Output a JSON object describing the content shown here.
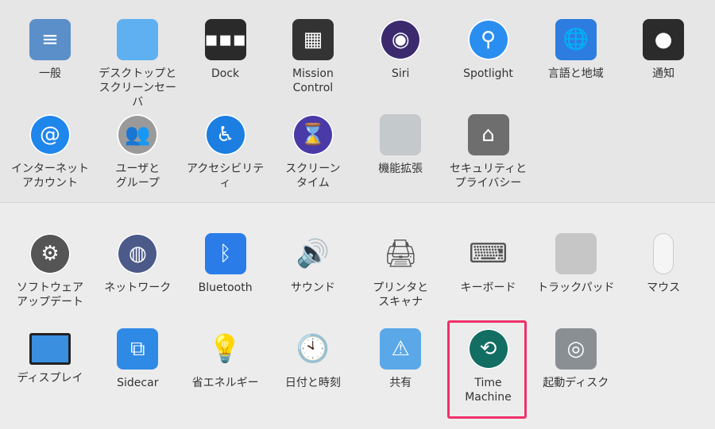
{
  "sections": [
    {
      "items": [
        {
          "label": "一般",
          "icon": "general-icon",
          "glyph": "≡",
          "bg": "#5a8fc9",
          "shape": "square"
        },
        {
          "label": "デスクトップと\nスクリーンセーバ",
          "icon": "desktop-screensaver-icon",
          "glyph": "",
          "bg": "#5fb0f0",
          "shape": "square"
        },
        {
          "label": "Dock",
          "icon": "dock-icon",
          "glyph": "▪▪▪",
          "bg": "#2a2a2a",
          "shape": "square"
        },
        {
          "label": "Mission\nControl",
          "icon": "mission-control-icon",
          "glyph": "▦",
          "bg": "#333333",
          "shape": "square"
        },
        {
          "label": "Siri",
          "icon": "siri-icon",
          "glyph": "◉",
          "bg": "#3b2a6e",
          "shape": "circle"
        },
        {
          "label": "Spotlight",
          "icon": "spotlight-icon",
          "glyph": "⚲",
          "bg": "#2a8ef0",
          "shape": "circle"
        },
        {
          "label": "言語と地域",
          "icon": "language-region-icon",
          "glyph": "🌐",
          "bg": "#2d7de0",
          "shape": "square"
        },
        {
          "label": "通知",
          "icon": "notifications-icon",
          "glyph": "●",
          "bg": "#2b2b2b",
          "shape": "square"
        }
      ]
    },
    {
      "items": [
        {
          "label": "インターネット\nアカウント",
          "icon": "internet-accounts-icon",
          "glyph": "@",
          "bg": "#1f86ec",
          "shape": "circle"
        },
        {
          "label": "ユーザと\nグループ",
          "icon": "users-groups-icon",
          "glyph": "👥",
          "bg": "#9a9a9a",
          "shape": "circle"
        },
        {
          "label": "アクセシビリティ",
          "icon": "accessibility-icon",
          "glyph": "♿",
          "bg": "#1b7ee0",
          "shape": "circle"
        },
        {
          "label": "スクリーン\nタイム",
          "icon": "screen-time-icon",
          "glyph": "⌛",
          "bg": "#4a3aa8",
          "shape": "circle"
        },
        {
          "label": "機能拡張",
          "icon": "extensions-icon",
          "glyph": "",
          "bg": "#c4c9cc",
          "shape": "square"
        },
        {
          "label": "セキュリティと\nプライバシー",
          "icon": "security-privacy-icon",
          "glyph": "⌂",
          "bg": "#6e6e6e",
          "shape": "square"
        }
      ]
    },
    {
      "items": [
        {
          "label": "ソフトウェア\nアップデート",
          "icon": "software-update-icon",
          "glyph": "⚙",
          "bg": "#555555",
          "shape": "circle"
        },
        {
          "label": "ネットワーク",
          "icon": "network-icon",
          "glyph": "◍",
          "bg": "#4c5a8a",
          "shape": "circle"
        },
        {
          "label": "Bluetooth",
          "icon": "bluetooth-icon",
          "glyph": "ᛒ",
          "bg": "#2a7de8",
          "shape": "square"
        },
        {
          "label": "サウンド",
          "icon": "sound-icon",
          "glyph": "🔊",
          "bg": "transparent",
          "shape": "square"
        },
        {
          "label": "プリンタと\nスキャナ",
          "icon": "printers-scanners-icon",
          "glyph": "🖨",
          "bg": "transparent",
          "shape": "square"
        },
        {
          "label": "キーボード",
          "icon": "keyboard-icon",
          "glyph": "⌨",
          "bg": "transparent",
          "shape": "square"
        },
        {
          "label": "トラックパッド",
          "icon": "trackpad-icon",
          "glyph": "",
          "bg": "#c6c6c6",
          "shape": "square"
        },
        {
          "label": "マウス",
          "icon": "mouse-icon",
          "glyph": "",
          "bg": "#f5f5f5",
          "shape": "mouse"
        }
      ]
    },
    {
      "items": [
        {
          "label": "ディスプレイ",
          "icon": "displays-icon",
          "glyph": "",
          "bg": "#3a8fe0",
          "shape": "display"
        },
        {
          "label": "Sidecar",
          "icon": "sidecar-icon",
          "glyph": "⧉",
          "bg": "#2f8ae6",
          "shape": "square"
        },
        {
          "label": "省エネルギー",
          "icon": "energy-saver-icon",
          "glyph": "💡",
          "bg": "transparent",
          "shape": "square"
        },
        {
          "label": "日付と時刻",
          "icon": "date-time-icon",
          "glyph": "🕙",
          "bg": "transparent",
          "shape": "square"
        },
        {
          "label": "共有",
          "icon": "sharing-icon",
          "glyph": "⚠",
          "bg": "#5aa8e8",
          "shape": "square"
        },
        {
          "label": "Time\nMachine",
          "icon": "time-machine-icon",
          "glyph": "⟲",
          "bg": "#126d62",
          "shape": "circle"
        },
        {
          "label": "起動ディスク",
          "icon": "startup-disk-icon",
          "glyph": "◎",
          "bg": "#8a8f94",
          "shape": "square"
        }
      ]
    }
  ],
  "highlight_color": "#f0306a"
}
